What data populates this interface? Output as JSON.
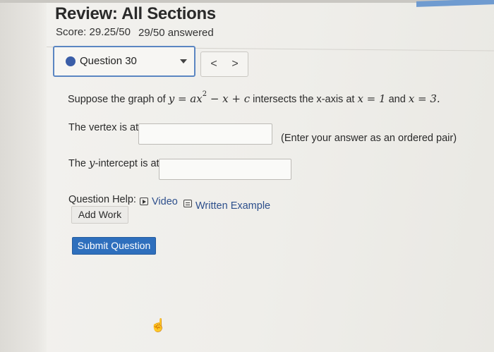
{
  "header": {
    "title": "Review: All Sections",
    "score": "Score: 29.25/50",
    "answered": "29/50 answered"
  },
  "question_select": {
    "label": "Question 30",
    "status_color": "#3b5ea8"
  },
  "nav": {
    "prev": "<",
    "next": ">"
  },
  "question": {
    "prompt_before": "Suppose the graph of",
    "equation": "y = ax² − x + c",
    "prompt_after": "intersects the x-axis at",
    "x1": "x = 1",
    "and": "and",
    "x2": "x = 3."
  },
  "vertex": {
    "label": "The vertex is at",
    "value": "",
    "hint": "(Enter your answer as an ordered pair)"
  },
  "yintercept": {
    "label_pre": "The",
    "label_var": "y",
    "label_post": "-intercept is at",
    "value": ""
  },
  "help": {
    "label": "Question Help:",
    "video": "Video",
    "written_example": "Written Example"
  },
  "buttons": {
    "add_work": "Add Work",
    "submit": "Submit Question"
  },
  "colors": {
    "accent": "#2e6fbd",
    "link": "#2d4f8c",
    "select_border": "#5b86c2"
  }
}
